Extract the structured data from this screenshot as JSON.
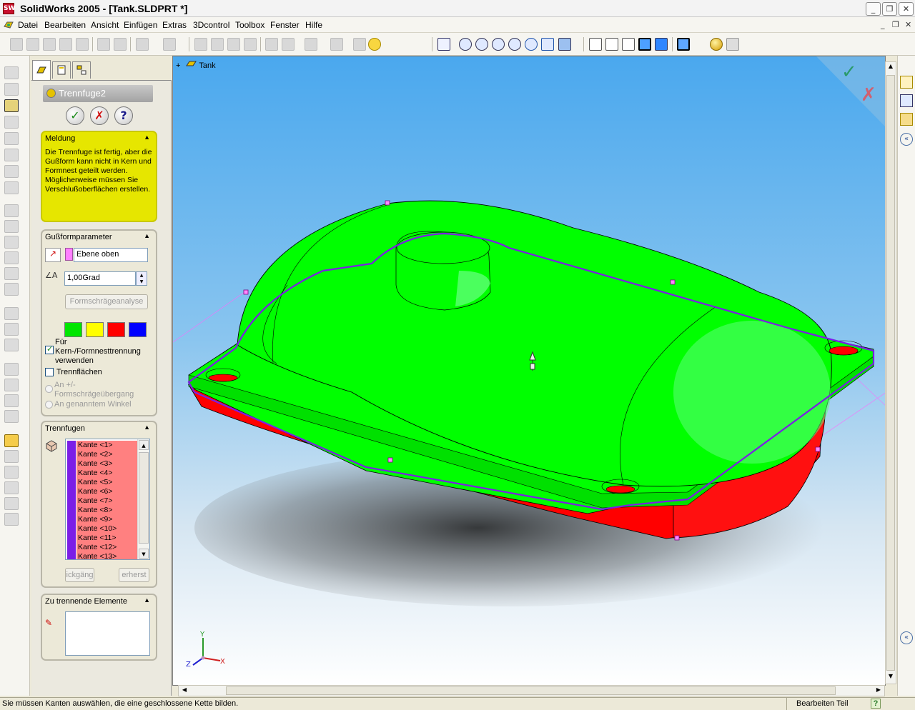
{
  "window": {
    "title": "SolidWorks 2005 - [Tank.SLDPRT *]"
  },
  "menu": [
    "Datei",
    "Bearbeiten",
    "Ansicht",
    "Einfügen",
    "Extras",
    "3Dcontrol",
    "Toolbox",
    "Fenster",
    "Hilfe"
  ],
  "panel": {
    "feature_title": "Trennfuge2",
    "message": {
      "header": "Meldung",
      "text": "Die Trennfuge ist fertig, aber die Gußform kann nicht in Kern und Formnest geteilt werden. Möglicherweise müssen Sie Verschlußoberflächen erstellen."
    },
    "mold_params": {
      "header": "Gußformparameter",
      "direction_value": "Ebene oben",
      "draft_value": "1,00Grad",
      "analysis_button": "Formschrägeanalyse",
      "swatch_colors": [
        "#00e600",
        "#ffff00",
        "#ff0000",
        "#0000ff"
      ],
      "check_core_cavity": "Für Kern-/Formnesttrennung verwenden",
      "check_core_cavity_checked": true,
      "check_parting_surfaces": "Trennflächen",
      "check_parting_surfaces_checked": false,
      "radio_1": "An +/- Formschrägeübergang",
      "radio_2": "An genanntem Winkel"
    },
    "parting_lines": {
      "header": "Trennfugen",
      "edges": [
        "Kante <1>",
        "Kante <2>",
        "Kante <3>",
        "Kante <4>",
        "Kante <5>",
        "Kante <6>",
        "Kante <7>",
        "Kante <8>",
        "Kante <9>",
        "Kante <10>",
        "Kante <11>",
        "Kante <12>",
        "Kante <13>"
      ],
      "undo_button": "ickgäng",
      "recreate_button": "erherst"
    },
    "split_entities": {
      "header": "Zu trennende Elemente"
    }
  },
  "viewport": {
    "tree_label": "Tank",
    "axis_x": "X",
    "axis_y": "Y",
    "axis_z": "Z"
  },
  "status": {
    "left": "Sie müssen Kanten auswählen, die eine geschlossene Kette bilden.",
    "right": "Bearbeiten Teil",
    "help": "?"
  },
  "colors": {
    "green_face": "#00ff00",
    "red_face": "#ff0000",
    "parting_line": "#7b1ee6",
    "message_bg": "#e6e600"
  }
}
